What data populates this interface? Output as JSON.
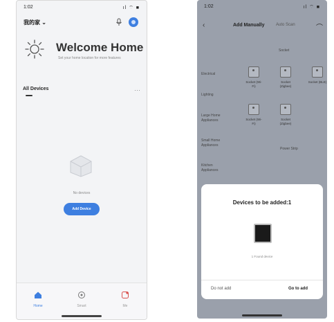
{
  "left": {
    "status": {
      "time": "1:02",
      "icons": "ıl ⌔ ■"
    },
    "home_name": "我的家",
    "home_chevron": "⌄",
    "welcome_title": "Welcome Home",
    "welcome_sub": "Set your home location for more features",
    "section_title": "All Devices",
    "more": "···",
    "empty_text": "No devices",
    "add_device_label": "Add Device",
    "tabs": [
      {
        "label": "Home",
        "icon": "home-icon",
        "active": true
      },
      {
        "label": "Smart",
        "icon": "smart-icon",
        "active": false
      },
      {
        "label": "Me",
        "icon": "profile-icon",
        "active": false
      }
    ]
  },
  "right": {
    "status": {
      "time": "1:02",
      "icons": "ıl ⌔ ■"
    },
    "nav": {
      "back": "‹",
      "tab_active": "Add Manually",
      "tab_other": "Auto Scan",
      "extra": "⌒"
    },
    "subheader": "Socket",
    "categories": [
      "Electrical",
      "Lighting",
      "Large Home Appliances",
      "Small Home Appliances",
      "Kitchen Appliances"
    ],
    "devices": [
      {
        "name": "Socket (Wi-Fi)"
      },
      {
        "name": "Socket (Zigbee)"
      },
      {
        "name": "Socket (BLE)"
      },
      {
        "name": "Socket (Wi-Fi)"
      },
      {
        "name": "Socket (Zigbee)"
      }
    ],
    "power_strip": "Power Strip",
    "dialog": {
      "title": "Devices to be added:1",
      "device_status": "1 Found device",
      "cancel": "Do not add",
      "confirm": "Go to add"
    }
  },
  "colors": {
    "accent": "#3e7fe0",
    "overlay": "#9aa0ab"
  }
}
